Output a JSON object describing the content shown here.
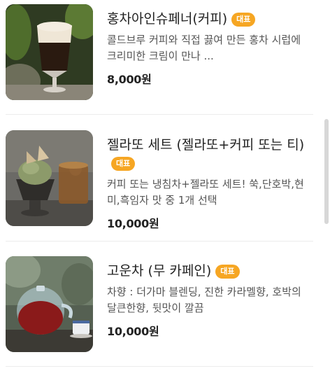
{
  "menu": {
    "badge_label": "대표",
    "items": [
      {
        "name": "홍차아인슈페너(커피)",
        "description": "콜드브루 커피와 직접 끓여 만든 홍차 시럽에 크리미한 크림이 만나 ...",
        "price": "8,000원",
        "image": "iced-einspanner-photo"
      },
      {
        "name": "젤라또 세트 (젤라또+커피 또는 티)",
        "description": "커피 또는 냉침차+젤라또 세트! 쑥,단호박,현미,흑임자 맛 중 1개 선택",
        "price": "10,000원",
        "image": "gelato-set-photo"
      },
      {
        "name": "고운차 (무 카페인)",
        "description": "차향 : 더가마 블렌딩, 진한 카라멜향, 호박의 달큰한향, 뒷맛이 깔끔",
        "price": "10,000원",
        "image": "teapot-photo"
      }
    ]
  },
  "colors": {
    "badge": "#f6a623",
    "price": "#222222",
    "description": "#555555"
  }
}
